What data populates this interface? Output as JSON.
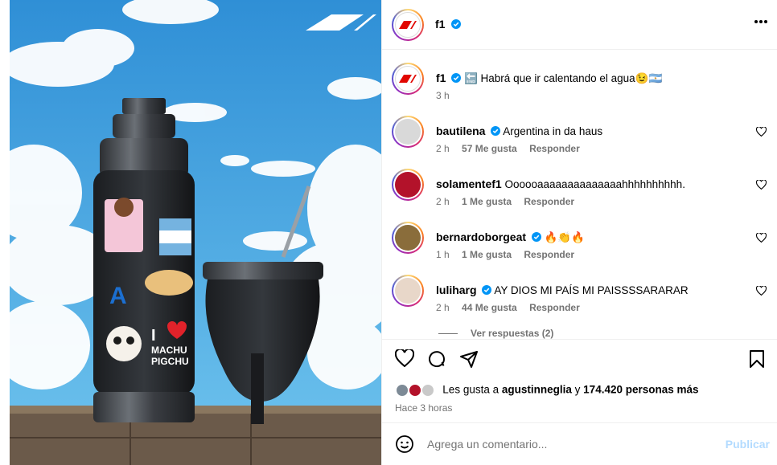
{
  "post": {
    "author": "f1",
    "more_icon": "more-horizontal-icon"
  },
  "caption": {
    "username": "f1",
    "text": "🔚 Habrá que ir calentando el agua😉🇦🇷",
    "time": "3 h"
  },
  "comments": [
    {
      "username": "bautilena",
      "text": "Argentina in da haus",
      "time": "2 h",
      "likes": "57 Me gusta",
      "reply": "Responder",
      "avatar_color": "#d9d9d9"
    },
    {
      "username": "solamentef1",
      "text": "Oooooaaaaaaaaaaaaaahhhhhhhhhh.",
      "time": "2 h",
      "likes": "1 Me gusta",
      "reply": "Responder",
      "avatar_color": "#b3122a"
    },
    {
      "username": "bernardoborgeat",
      "text": "🔥👏🔥",
      "time": "1 h",
      "likes": "1 Me gusta",
      "reply": "Responder",
      "avatar_color": "#8a6d3b"
    },
    {
      "username": "luliharg",
      "text": "AY DIOS MI PAÍS MI PAISSSSARARAR",
      "time": "2 h",
      "likes": "44 Me gusta",
      "reply": "Responder",
      "avatar_color": "#e8d7c9"
    }
  ],
  "view_replies": "Ver respuestas (2)",
  "likes_line": {
    "prefix": "Les gusta a",
    "user": "agustinneglia",
    "middle": "y",
    "count": "174.420 personas más"
  },
  "time_ago": "Hace 3 horas",
  "add_comment": {
    "placeholder": "Agrega un comentario...",
    "post_label": "Publicar"
  },
  "media": {
    "brand_logo": "F1",
    "sticker_text": "I ❤ MACHU PIGCHU"
  },
  "colors": {
    "verified": "#0095f6",
    "muted": "#737373",
    "post_disabled": "#b3dbff"
  }
}
